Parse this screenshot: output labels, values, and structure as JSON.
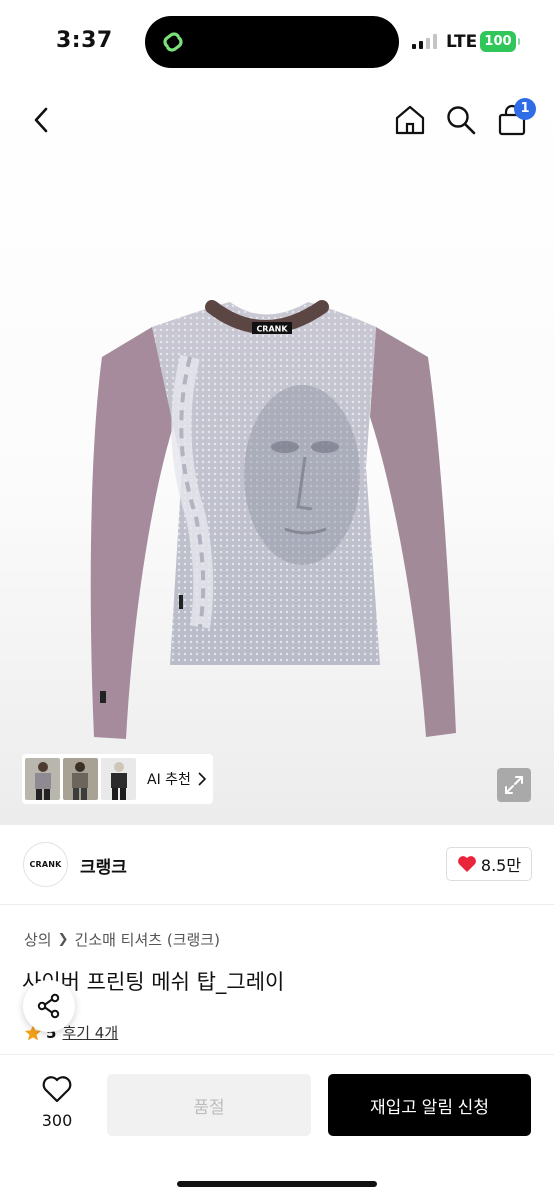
{
  "status_bar": {
    "time": "3:37",
    "network": "LTE",
    "battery": "100"
  },
  "header": {
    "cart_count": "1"
  },
  "product_image": {
    "neck_label": "CRANK"
  },
  "thumbnails": {
    "ai_label": "AI 추천"
  },
  "brand": {
    "logo_text": "CRANK",
    "name": "크랭크",
    "likes": "8.5만"
  },
  "breadcrumb": {
    "category": "상의",
    "subcategory": "긴소매 티셔츠 (크랭크)"
  },
  "product": {
    "title": "사이버 프린팅 메쉬 탑_그레이",
    "rating": "5",
    "reviews": "후기 4개"
  },
  "bottom_bar": {
    "wish_count": "300",
    "soldout_label": "품절",
    "restock_label": "재입고 알림 신청"
  },
  "colors": {
    "accent": "#2f6de6",
    "heart": "#e8253a",
    "battery": "#31c65a",
    "island_logo": "#7ae27a"
  }
}
